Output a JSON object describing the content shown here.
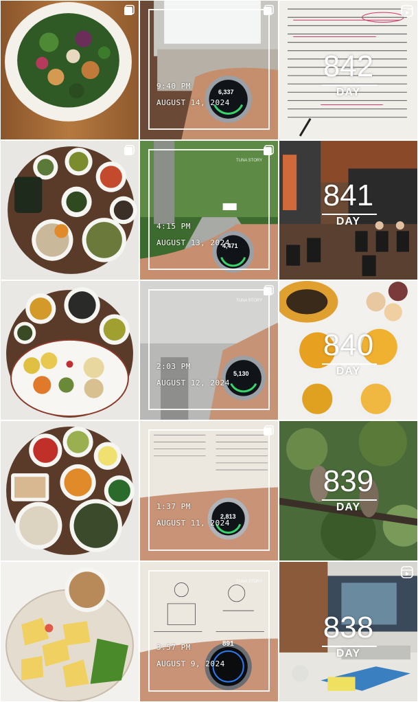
{
  "grid": {
    "rows": [
      {
        "meal_tile": {
          "alt": "salad bowl"
        },
        "watch_tile": {
          "time": "9:40 PM",
          "date": "AUGUST 14, 2024",
          "steps": "6,337"
        },
        "day_tile": {
          "day_number": "842",
          "day_label": "DAY",
          "type": "reel"
        }
      },
      {
        "meal_tile": {
          "alt": "korean banchan tray"
        },
        "watch_tile": {
          "time": "4:15 PM",
          "date": "AUGUST 13, 2024",
          "steps": "4,471",
          "watermark": "TUNA STORY"
        },
        "day_tile": {
          "day_number": "841",
          "day_label": "DAY",
          "type": "photo"
        }
      },
      {
        "meal_tile": {
          "alt": "meal plate with squash"
        },
        "watch_tile": {
          "time": "2:03 PM",
          "date": "AUGUST 12, 2024",
          "steps": "5,130",
          "watermark": "TUNA STORY"
        },
        "day_tile": {
          "day_number": "840",
          "day_label": "DAY",
          "type": "photo"
        }
      },
      {
        "meal_tile": {
          "alt": "tray with rice and soup"
        },
        "watch_tile": {
          "time": "1:37 PM",
          "date": "AUGUST 11, 2024",
          "steps": "2,813"
        },
        "day_tile": {
          "day_number": "839",
          "day_label": "DAY",
          "type": "photo"
        }
      },
      {
        "meal_tile": {
          "alt": "apples and nuts"
        },
        "watch_tile": {
          "time": "3:57 PM",
          "date": "AUGUST 9, 2024",
          "steps": "891",
          "watermark": "TUNA STORY"
        },
        "day_tile": {
          "day_number": "838",
          "day_label": "DAY",
          "type": "reel"
        }
      }
    ]
  },
  "icons": {
    "multi": "multiple-photos-icon",
    "reel": "reel-play-icon"
  },
  "colors": {
    "step_ring": "#39d36b",
    "watch_face": "#101418",
    "frame": "#ffffff"
  }
}
